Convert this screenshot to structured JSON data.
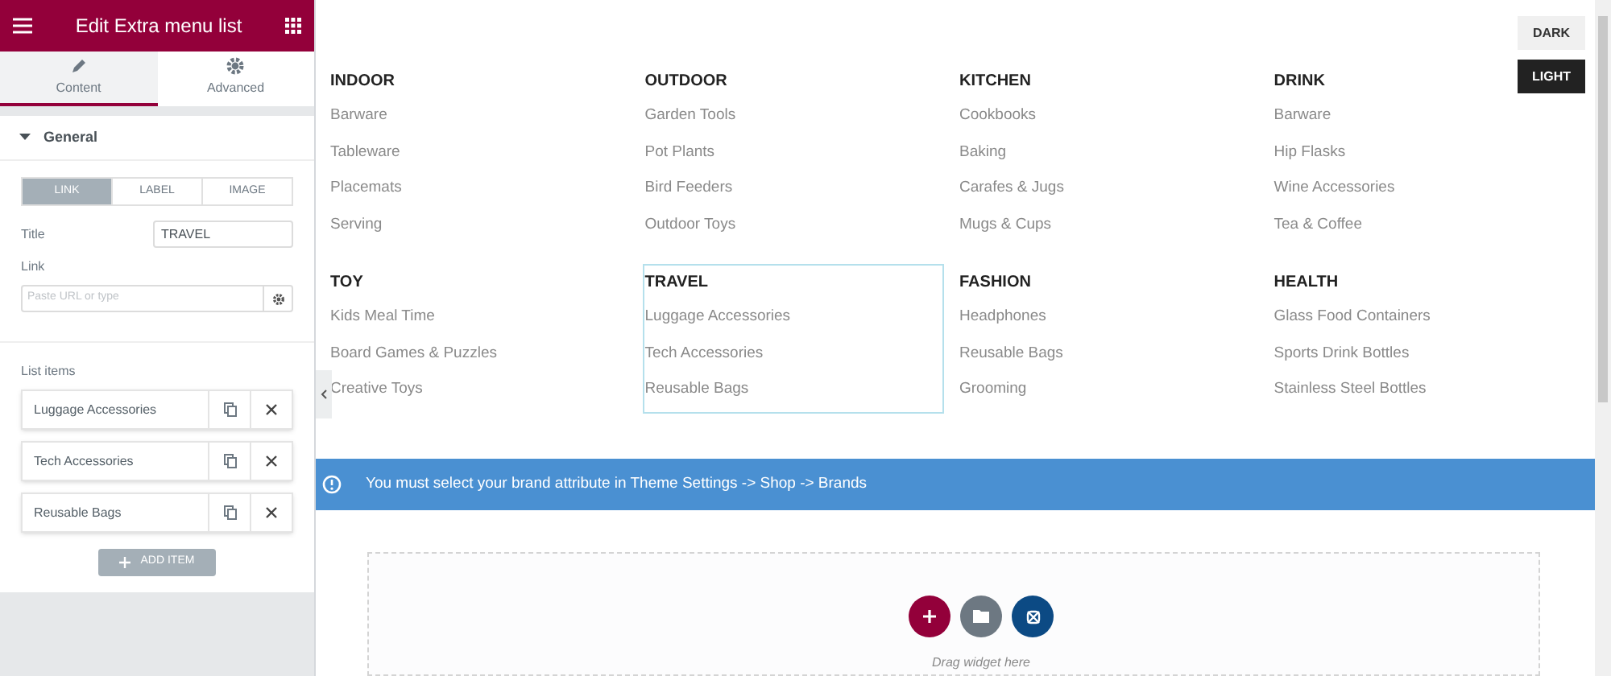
{
  "panel": {
    "title": "Edit Extra menu list",
    "tabs": [
      {
        "label": "Content",
        "selected": true
      },
      {
        "label": "Advanced",
        "selected": false
      }
    ],
    "section": {
      "title": "General"
    },
    "link_types": [
      {
        "label": "LINK",
        "selected": true
      },
      {
        "label": "LABEL",
        "selected": false
      },
      {
        "label": "IMAGE",
        "selected": false
      }
    ],
    "title_field": {
      "label": "Title",
      "value": "TRAVEL"
    },
    "link_field": {
      "label": "Link",
      "placeholder": "Paste URL or type"
    },
    "list_items": {
      "label": "List items",
      "items": [
        "Luggage Accessories",
        "Tech Accessories",
        "Reusable Bags"
      ]
    },
    "add_item_button": "ADD ITEM"
  },
  "canvas": {
    "theme_buttons": [
      {
        "label": "DARK",
        "selected": false
      },
      {
        "label": "LIGHT",
        "selected": true
      }
    ],
    "menu_groups": [
      {
        "title": "INDOOR",
        "selected": false,
        "items": [
          "Barware",
          "Tableware",
          "Placemats",
          "Serving"
        ]
      },
      {
        "title": "OUTDOOR",
        "selected": false,
        "items": [
          "Garden Tools",
          "Pot Plants",
          "Bird Feeders",
          "Outdoor Toys"
        ]
      },
      {
        "title": "KITCHEN",
        "selected": false,
        "items": [
          "Cookbooks",
          "Baking",
          "Carafes & Jugs",
          "Mugs & Cups"
        ]
      },
      {
        "title": "DRINK",
        "selected": false,
        "items": [
          "Barware",
          "Hip Flasks",
          "Wine Accessories",
          "Tea & Coffee"
        ]
      },
      {
        "title": "TOY",
        "selected": false,
        "items": [
          "Kids Meal Time",
          "Board Games & Puzzles",
          "Creative Toys"
        ]
      },
      {
        "title": "TRAVEL",
        "selected": true,
        "items": [
          "Luggage Accessories",
          "Tech Accessories",
          "Reusable Bags"
        ]
      },
      {
        "title": "FASHION",
        "selected": false,
        "items": [
          "Headphones",
          "Reusable Bags",
          "Grooming"
        ]
      },
      {
        "title": "HEALTH",
        "selected": false,
        "items": [
          "Glass Food Containers",
          "Sports Drink Bottles",
          "Stainless Steel Bottles"
        ]
      }
    ],
    "notice": "You must select your brand attribute in Theme Settings -> Shop -> Brands",
    "drop_area": {
      "hint": "Drag widget here"
    }
  }
}
